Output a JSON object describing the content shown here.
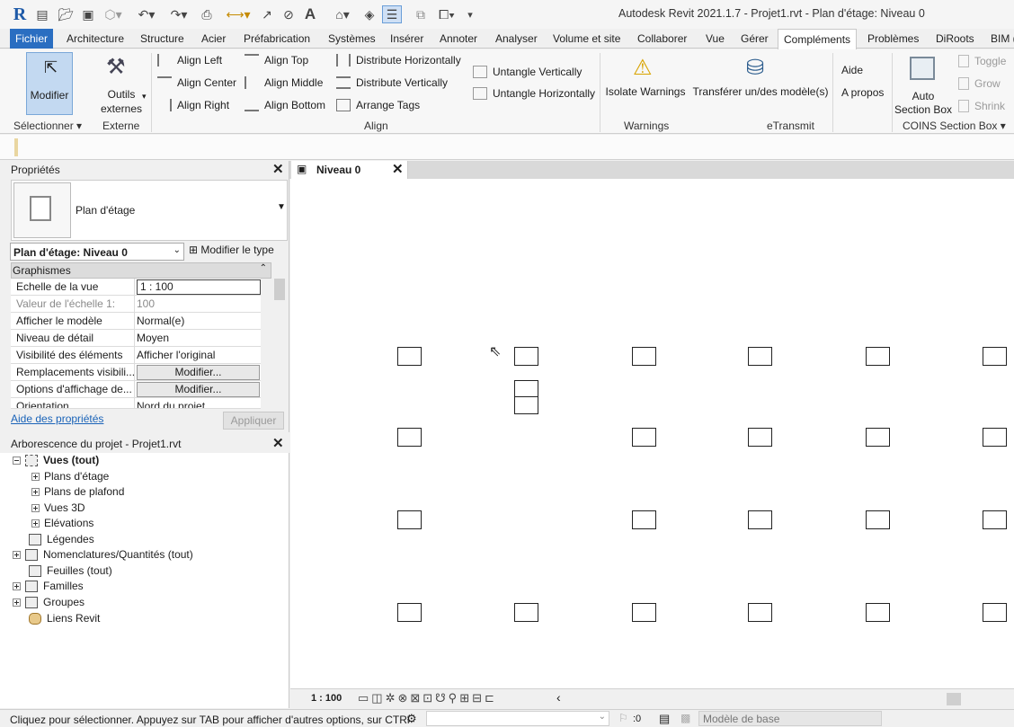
{
  "titlebar": {
    "title": "Autodesk Revit 2021.1.7 - Projet1.rvt - Plan d'étage: Niveau 0"
  },
  "menu": {
    "tabs": [
      "Fichier",
      "Architecture",
      "Structure",
      "Acier",
      "Préfabrication",
      "Systèmes",
      "Insérer",
      "Annoter",
      "Analyser",
      "Volume et site",
      "Collaborer",
      "Vue",
      "Gérer",
      "Compléments",
      "Problèmes",
      "DiRoots",
      "BIM ("
    ],
    "active": "Compléments"
  },
  "ribbon": {
    "modifier": "Modifier",
    "outils_line1": "Outils",
    "outils_line2": "externes",
    "align_left": "Align Left",
    "align_center": "Align Center",
    "align_right": "Align Right",
    "align_top": "Align Top",
    "align_middle": "Align Middle",
    "align_bottom": "Align Bottom",
    "distribute_h": "Distribute Horizontally",
    "distribute_v": "Distribute Vertically",
    "arrange_tags": "Arrange Tags",
    "untangle_v": "Untangle Vertically",
    "untangle_h": "Untangle Horizontally",
    "isolate_warnings": "Isolate Warnings",
    "transferer": "Transférer un/des modèle(s)",
    "aide": "Aide",
    "apropos": "A propos",
    "auto_line1": "Auto",
    "auto_line2": "Section Box",
    "toggle": "Toggle",
    "grow": "Grow",
    "shrink": "Shrink",
    "groups": {
      "selectionner": "Sélectionner",
      "externe": "Externe",
      "align": "Align",
      "warnings": "Warnings",
      "etransmit": "eTransmit",
      "coins": "COINS Section Box"
    }
  },
  "properties": {
    "panel_title": "Propriétés",
    "type_name": "Plan d'étage",
    "selector_value": "Plan d'étage: Niveau 0",
    "modifier_type": "Modifier le type",
    "section": "Graphismes",
    "rows": [
      {
        "key": "Echelle de la vue",
        "value": "1 : 100"
      },
      {
        "key": "Valeur de l'échelle    1:",
        "value": "100"
      },
      {
        "key": "Afficher le modèle",
        "value": "Normal(e)"
      },
      {
        "key": "Niveau de détail",
        "value": "Moyen"
      },
      {
        "key": "Visibilité des éléments",
        "value": "Afficher l'original"
      },
      {
        "key": "Remplacements visibili...",
        "value": "Modifier..."
      },
      {
        "key": "Options d'affichage de...",
        "value": "Modifier..."
      },
      {
        "key": "Orientation",
        "value": "Nord du projet"
      }
    ],
    "help_link": "Aide des propriétés",
    "apply_button": "Appliquer"
  },
  "browser": {
    "panel_title": "Arborescence du projet - Projet1.rvt",
    "items": [
      "Vues (tout)",
      "Plans d'étage",
      "Plans de plafond",
      "Vues 3D",
      "Elévations",
      "Légendes",
      "Nomenclatures/Quantités (tout)",
      "Feuilles (tout)",
      "Familles",
      "Groupes",
      "Liens Revit"
    ]
  },
  "view": {
    "tab_label": "Niveau 0",
    "scale": "1 : 100"
  },
  "status": {
    "message": "Cliquez pour sélectionner. Appuyez sur TAB pour afficher d'autres options, sur CTRl",
    "count": ":0",
    "model": "Modèle de base"
  }
}
